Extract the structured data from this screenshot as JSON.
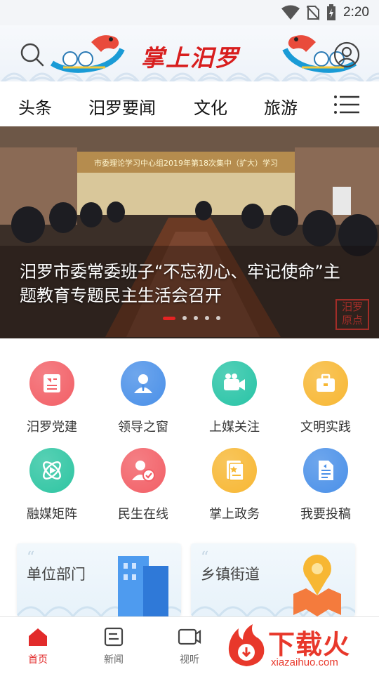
{
  "status_bar": {
    "time": "2:20"
  },
  "header": {
    "logo_text": "掌上汨罗"
  },
  "tabs": [
    {
      "label": "头条"
    },
    {
      "label": "汨罗要闻"
    },
    {
      "label": "文化"
    },
    {
      "label": "旅游"
    }
  ],
  "banner": {
    "title": "汨罗市委常委班子“不忘初心、牢记使命”主题教育专题民主生活会召开",
    "photo_sign": "市委理论学习中心组2019年第18次集中（扩大）学习",
    "stamp": "汨罗 原点",
    "slide_count": 5,
    "active_slide": 1
  },
  "grid": [
    {
      "label": "汨罗党建",
      "icon": "party-building-icon",
      "color": "#f25f66"
    },
    {
      "label": "领导之窗",
      "icon": "leader-icon",
      "color": "#4a90e8"
    },
    {
      "label": "上媒关注",
      "icon": "video-camera-icon",
      "color": "#28c4a6"
    },
    {
      "label": "文明实践",
      "icon": "briefcase-icon",
      "color": "#f7b733"
    },
    {
      "label": "融媒矩阵",
      "icon": "atom-icon",
      "color": "#2ec5a2"
    },
    {
      "label": "民生在线",
      "icon": "user-check-icon",
      "color": "#f25f66"
    },
    {
      "label": "掌上政务",
      "icon": "document-star-icon",
      "color": "#f7b733"
    },
    {
      "label": "我要投稿",
      "icon": "submit-doc-icon",
      "color": "#4a90e8"
    }
  ],
  "cards": [
    {
      "title": "单位部门",
      "icon": "building-icon"
    },
    {
      "title": "乡镇街道",
      "icon": "map-pin-icon"
    }
  ],
  "bottom_nav": [
    {
      "label": "首页",
      "icon": "home-icon",
      "active": true
    },
    {
      "label": "新闻",
      "icon": "news-icon",
      "active": false
    },
    {
      "label": "视听",
      "icon": "tv-icon",
      "active": false
    }
  ],
  "watermark": {
    "name": "下载火",
    "url": "xiazaihuo.com"
  }
}
